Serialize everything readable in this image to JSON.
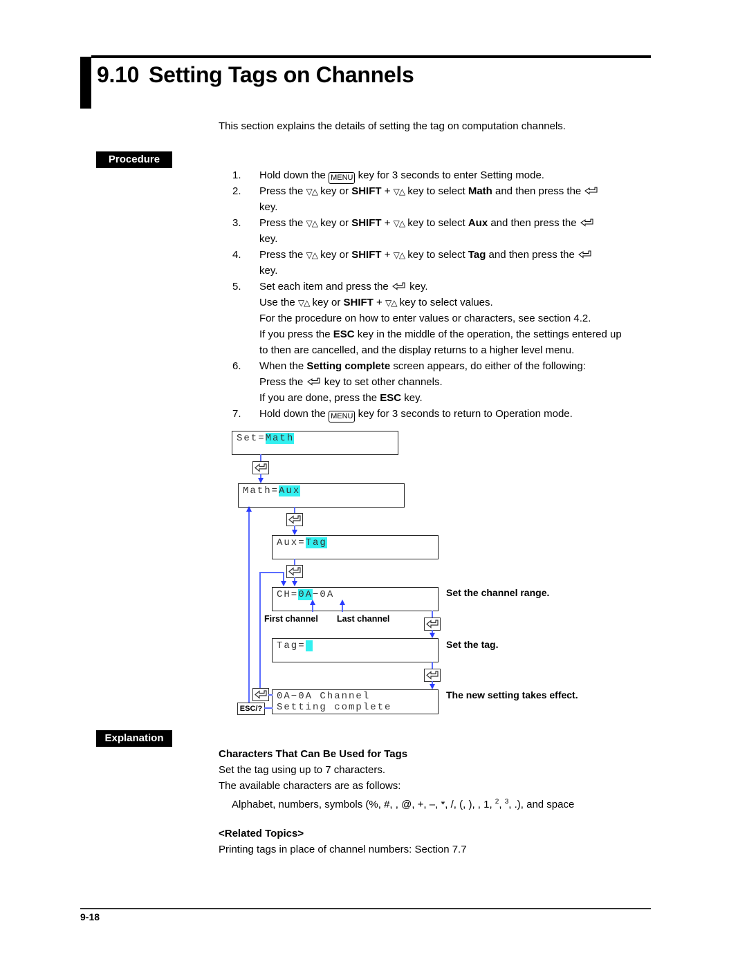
{
  "header": {
    "section_number": "9.10",
    "title": "Setting Tags on Channels",
    "intro": "This section explains the details of setting the tag on computation channels."
  },
  "labels": {
    "procedure": "Procedure",
    "explanation": "Explanation"
  },
  "glyphs": {
    "menu_key": "MENU",
    "updown": "▽△",
    "enter": "↵",
    "shift": "SHIFT",
    "esc": "ESC"
  },
  "steps": [
    {
      "num": "1.",
      "lines": [
        [
          "Hold down the ",
          {
            "k": "menu"
          },
          " key for 3 seconds to enter Setting mode."
        ]
      ]
    },
    {
      "num": "2.",
      "lines": [
        [
          "Press the ",
          {
            "k": "updown"
          },
          " key or ",
          {
            "b": "SHIFT"
          },
          " + ",
          {
            "k": "updown"
          },
          " key to select ",
          {
            "b": "Math"
          },
          " and then press the ",
          {
            "k": "enter"
          }
        ],
        [
          "key."
        ]
      ]
    },
    {
      "num": "3.",
      "lines": [
        [
          "Press the ",
          {
            "k": "updown"
          },
          " key or ",
          {
            "b": "SHIFT"
          },
          " + ",
          {
            "k": "updown"
          },
          " key to select ",
          {
            "b": "Aux"
          },
          " and then press the ",
          {
            "k": "enter"
          }
        ],
        [
          "key."
        ]
      ]
    },
    {
      "num": "4.",
      "lines": [
        [
          "Press the ",
          {
            "k": "updown"
          },
          " key or ",
          {
            "b": "SHIFT"
          },
          " + ",
          {
            "k": "updown"
          },
          " key to select ",
          {
            "b": "Tag"
          },
          " and then press the ",
          {
            "k": "enter"
          }
        ],
        [
          "key."
        ]
      ]
    },
    {
      "num": "5.",
      "lines": [
        [
          "Set each item and press the ",
          {
            "k": "enter"
          },
          " key."
        ],
        [
          "Use the ",
          {
            "k": "updown"
          },
          " key or ",
          {
            "b": "SHIFT"
          },
          " + ",
          {
            "k": "updown"
          },
          " key to select values."
        ],
        [
          "For the procedure on how to enter values or characters, see section 4.2."
        ],
        [
          "If you press the ",
          {
            "b": "ESC"
          },
          " key in the middle of the operation, the settings entered up"
        ],
        [
          "to then are cancelled, and the display returns to a higher level menu."
        ]
      ]
    },
    {
      "num": "6.",
      "lines": [
        [
          "When the ",
          {
            "b": "Setting complete"
          },
          " screen appears, do either of the following:"
        ],
        [
          "Press the ",
          {
            "k": "enter"
          },
          " key to set other channels."
        ],
        [
          "If you are done, press the ",
          {
            "b": "ESC"
          },
          " key."
        ]
      ]
    },
    {
      "num": "7.",
      "lines": [
        [
          "Hold down the ",
          {
            "k": "menu"
          },
          " key for 3 seconds to return to Operation mode."
        ]
      ]
    }
  ],
  "diagram": {
    "screen1": {
      "prefix": "Set=",
      "value": "Math"
    },
    "screen2": {
      "prefix": "Math=",
      "value": "Aux"
    },
    "screen3": {
      "prefix": "Aux=",
      "value": "Tag"
    },
    "screen4": {
      "prefix": "CH=",
      "value": "0A",
      "suffix": "−0A"
    },
    "screen5": {
      "prefix": "Tag=",
      "value": " "
    },
    "screen6": {
      "line1": "0A−0A Channel",
      "line2": "Setting complete"
    },
    "first_channel": "First channel",
    "last_channel": "Last channel",
    "esc_key": "ESC/?",
    "note_range": "Set the channel range.",
    "note_tag": "Set the tag.",
    "note_effect": "The new setting takes effect."
  },
  "explanation": {
    "heading": "Characters That Can Be Used for Tags",
    "line1": "Set the tag using up to 7 characters.",
    "line2": "The available characters are as follows:",
    "chars_line_a": "Alphabet, numbers, symbols (%, #,   , @, +, –, *, /, (, ),   ,  1, ",
    "sup2": "2",
    "chars_line_b": ", ",
    "sup3": "3",
    "chars_line_c": ", .), and space",
    "related_heading": "<Related Topics>",
    "related_text": "Printing tags in place of channel numbers: Section 7.7"
  },
  "footer": {
    "page_number": "9-18"
  }
}
